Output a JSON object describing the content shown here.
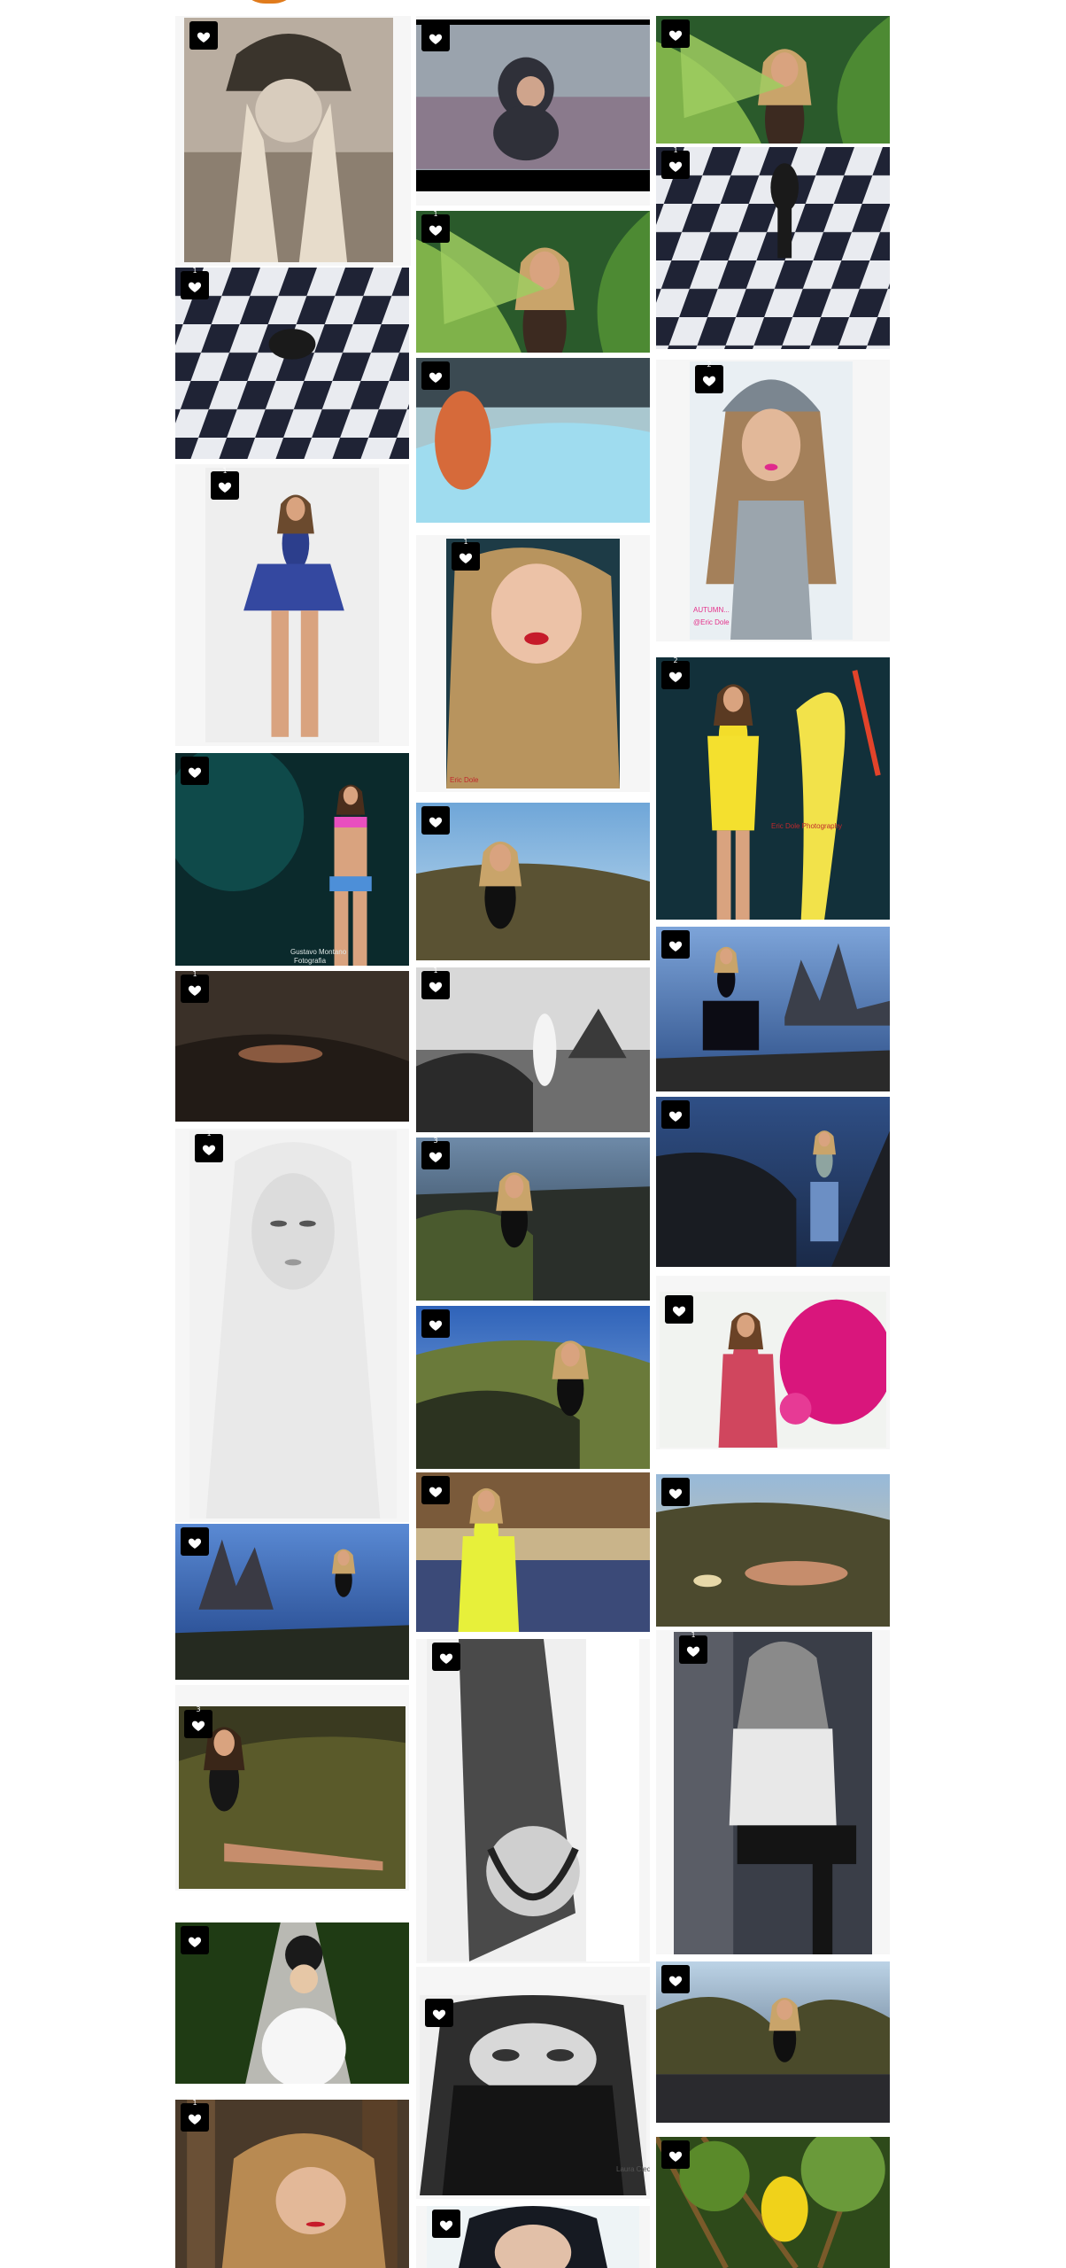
{
  "gallery": {
    "like_icon": "heart-icon",
    "badge_color": "#000000",
    "photos": [
      {
        "id": "p01",
        "alt": "portrait-knit-hat-sepia",
        "likes": ""
      },
      {
        "id": "p02",
        "alt": "hooded-woman-in-flowers",
        "likes": ""
      },
      {
        "id": "p03",
        "alt": "woman-behind-palm-leaves",
        "likes": ""
      },
      {
        "id": "p04",
        "alt": "woman-on-checkered-floor",
        "likes": "1"
      },
      {
        "id": "p05",
        "alt": "palm-leaves-portrait",
        "likes": "1"
      },
      {
        "id": "p06",
        "alt": "figure-on-checkered-floor",
        "likes": "1"
      },
      {
        "id": "p07",
        "alt": "woman-by-pool",
        "likes": ""
      },
      {
        "id": "p08",
        "alt": "woman-in-knit-beanie",
        "likes": "2"
      },
      {
        "id": "p09",
        "alt": "woman-in-blue-dress",
        "likes": "1"
      },
      {
        "id": "p10",
        "alt": "red-lips-portrait",
        "likes": "1"
      },
      {
        "id": "p11",
        "alt": "yellow-dress-art",
        "likes": "2"
      },
      {
        "id": "p12",
        "alt": "bikini-dark-leaves",
        "likes": ""
      },
      {
        "id": "p13",
        "alt": "woman-on-rocks-sky",
        "likes": ""
      },
      {
        "id": "p14",
        "alt": "woman-on-dark-sand",
        "likes": "1"
      },
      {
        "id": "p15",
        "alt": "bw-beach-scene",
        "likes": "1"
      },
      {
        "id": "p16",
        "alt": "woman-by-sea-cliffs",
        "likes": ""
      },
      {
        "id": "p17",
        "alt": "woman-sitting-on-rocks-blue",
        "likes": ""
      },
      {
        "id": "p18",
        "alt": "bw-blonde-portrait",
        "likes": "1"
      },
      {
        "id": "p19",
        "alt": "kneeling-on-rocks",
        "likes": "3"
      },
      {
        "id": "p20",
        "alt": "pink-flowers-woman",
        "likes": ""
      },
      {
        "id": "p21",
        "alt": "green-hills-woman",
        "likes": ""
      },
      {
        "id": "p22",
        "alt": "sea-stacks-blue",
        "likes": ""
      },
      {
        "id": "p23",
        "alt": "yellow-swimsuit",
        "likes": ""
      },
      {
        "id": "p24",
        "alt": "lying-on-rocks",
        "likes": ""
      },
      {
        "id": "p25",
        "alt": "sitting-on-rocks-dark",
        "likes": "3"
      },
      {
        "id": "p26",
        "alt": "bw-curtain-portrait",
        "likes": ""
      },
      {
        "id": "p27",
        "alt": "bw-jacket-portrait",
        "likes": "1"
      },
      {
        "id": "p28",
        "alt": "white-fur-road",
        "likes": ""
      },
      {
        "id": "p29",
        "alt": "veiled-eyes-portrait",
        "likes": ""
      },
      {
        "id": "p30",
        "alt": "kneeling-by-sea",
        "likes": ""
      },
      {
        "id": "p31",
        "alt": "woman-in-wood",
        "likes": "1"
      },
      {
        "id": "p32",
        "alt": "dark-hair-portrait",
        "likes": ""
      },
      {
        "id": "p33",
        "alt": "yellow-hood-forest",
        "likes": ""
      }
    ],
    "captions": {
      "p08_line1": "AUTUMN...",
      "p08_line2": "@Eric Dole",
      "p10": "Eric Dole",
      "p11": "Eric Dole Photography",
      "p12_line1": "Gustavo Montano",
      "p12_line2": "Fotografia",
      "p29": "Laura Cledo"
    }
  }
}
